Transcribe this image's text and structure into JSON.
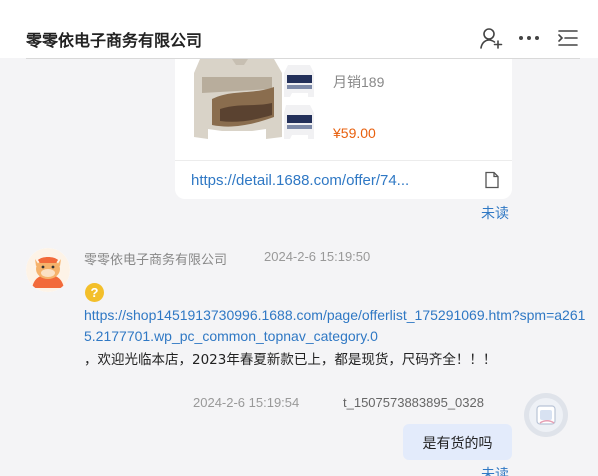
{
  "header": {
    "title": "零零依电子商务有限公司",
    "icons": [
      "add-contact-icon",
      "more-icon",
      "menu-list-icon"
    ]
  },
  "product_card": {
    "sales": "月销189",
    "price": "¥59.00",
    "link": "https://detail.1688.com/offer/74..."
  },
  "messages": {
    "unread_label": "未读",
    "incoming": {
      "sender": "零零依电子商务有限公司",
      "time": "2024-2-6 15:19:50",
      "emoji": "?",
      "link": "https://shop1451913730996.1688.com/page/offerlist_175291069.htm?spm=a2615.2177701.wp_pc_common_topnav_category.0",
      "text": "，欢迎光临本店，2023年春夏新款已上，都是现货，尺码齐全！！！"
    },
    "outgoing": {
      "time": "2024-2-6 15:19:54",
      "user": "t_1507573883895_0328",
      "text": "是有货的吗"
    }
  },
  "colors": {
    "link": "#2f78c4",
    "price": "#e8600e",
    "bubble": "#e3ebfb",
    "emoji": "#f3bf2a"
  }
}
